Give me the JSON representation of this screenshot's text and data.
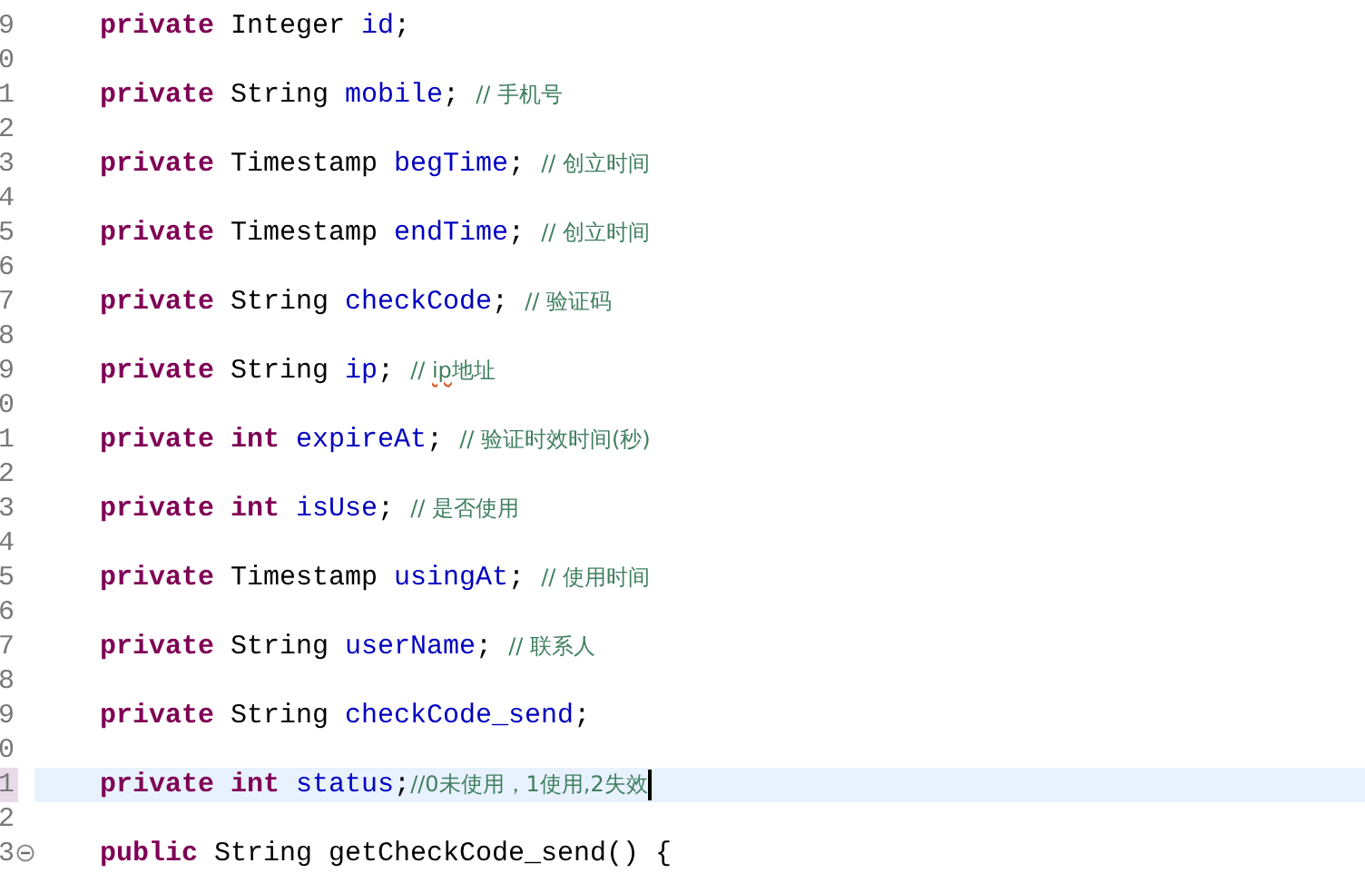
{
  "editor": {
    "lines": [
      {
        "number": "9",
        "selected": false,
        "segments": [
          {
            "kind": "keyword",
            "text": "private "
          },
          {
            "kind": "plain",
            "text": "Integer "
          },
          {
            "kind": "field",
            "text": "id"
          },
          {
            "kind": "plain",
            "text": ";"
          }
        ]
      },
      {
        "number": "0",
        "selected": false
      },
      {
        "number": "1",
        "selected": false,
        "segments": [
          {
            "kind": "keyword",
            "text": "private "
          },
          {
            "kind": "plain",
            "text": "String "
          },
          {
            "kind": "field",
            "text": "mobile"
          },
          {
            "kind": "plain",
            "text": "; "
          },
          {
            "kind": "comment",
            "text": "// 手机号"
          }
        ]
      },
      {
        "number": "2",
        "selected": false
      },
      {
        "number": "3",
        "selected": false,
        "segments": [
          {
            "kind": "keyword",
            "text": "private "
          },
          {
            "kind": "plain",
            "text": "Timestamp "
          },
          {
            "kind": "field",
            "text": "begTime"
          },
          {
            "kind": "plain",
            "text": "; "
          },
          {
            "kind": "comment",
            "text": "// 创立时间"
          }
        ]
      },
      {
        "number": "4",
        "selected": false
      },
      {
        "number": "5",
        "selected": false,
        "segments": [
          {
            "kind": "keyword",
            "text": "private "
          },
          {
            "kind": "plain",
            "text": "Timestamp "
          },
          {
            "kind": "field",
            "text": "endTime"
          },
          {
            "kind": "plain",
            "text": "; "
          },
          {
            "kind": "comment",
            "text": "// 创立时间"
          }
        ]
      },
      {
        "number": "6",
        "selected": false
      },
      {
        "number": "7",
        "selected": false,
        "segments": [
          {
            "kind": "keyword",
            "text": "private "
          },
          {
            "kind": "plain",
            "text": "String "
          },
          {
            "kind": "field",
            "text": "checkCode"
          },
          {
            "kind": "plain",
            "text": "; "
          },
          {
            "kind": "comment",
            "text": "// 验证码"
          }
        ]
      },
      {
        "number": "8",
        "selected": false
      },
      {
        "number": "9",
        "selected": false,
        "segments": [
          {
            "kind": "keyword",
            "text": "private "
          },
          {
            "kind": "plain",
            "text": "String "
          },
          {
            "kind": "field",
            "text": "ip"
          },
          {
            "kind": "plain",
            "text": "; "
          },
          {
            "kind": "comment",
            "text": "// "
          },
          {
            "kind": "misspelled",
            "text": "ip"
          },
          {
            "kind": "comment",
            "text": "地址"
          }
        ]
      },
      {
        "number": "0",
        "selected": false
      },
      {
        "number": "1",
        "selected": false,
        "segments": [
          {
            "kind": "keyword",
            "text": "private int "
          },
          {
            "kind": "field",
            "text": "expireAt"
          },
          {
            "kind": "plain",
            "text": "; "
          },
          {
            "kind": "comment",
            "text": "// 验证时效时间(秒)"
          }
        ]
      },
      {
        "number": "2",
        "selected": false
      },
      {
        "number": "3",
        "selected": false,
        "segments": [
          {
            "kind": "keyword",
            "text": "private int "
          },
          {
            "kind": "field",
            "text": "isUse"
          },
          {
            "kind": "plain",
            "text": "; "
          },
          {
            "kind": "comment",
            "text": "// 是否使用"
          }
        ]
      },
      {
        "number": "4",
        "selected": false
      },
      {
        "number": "5",
        "selected": false,
        "segments": [
          {
            "kind": "keyword",
            "text": "private "
          },
          {
            "kind": "plain",
            "text": "Timestamp "
          },
          {
            "kind": "field",
            "text": "usingAt"
          },
          {
            "kind": "plain",
            "text": "; "
          },
          {
            "kind": "comment",
            "text": "// 使用时间"
          }
        ]
      },
      {
        "number": "6",
        "selected": false
      },
      {
        "number": "7",
        "selected": false,
        "segments": [
          {
            "kind": "keyword",
            "text": "private "
          },
          {
            "kind": "plain",
            "text": "String "
          },
          {
            "kind": "field",
            "text": "userName"
          },
          {
            "kind": "plain",
            "text": "; "
          },
          {
            "kind": "comment",
            "text": "// 联系人"
          }
        ]
      },
      {
        "number": "8",
        "selected": false
      },
      {
        "number": "9",
        "selected": false,
        "segments": [
          {
            "kind": "keyword",
            "text": "private "
          },
          {
            "kind": "plain",
            "text": "String "
          },
          {
            "kind": "field",
            "text": "checkCode_send"
          },
          {
            "kind": "plain",
            "text": ";"
          }
        ]
      },
      {
        "number": "0",
        "selected": false
      },
      {
        "number": "1",
        "selected": true,
        "segments": [
          {
            "kind": "keyword",
            "text": "private int "
          },
          {
            "kind": "field",
            "text": "status"
          },
          {
            "kind": "plain",
            "text": ";"
          },
          {
            "kind": "comment",
            "text": "//0未使用，1使用,2失效"
          }
        ]
      },
      {
        "number": "2",
        "selected": false
      },
      {
        "number": "3",
        "selected": false,
        "foldable": true,
        "segments": [
          {
            "kind": "keyword",
            "text": "public "
          },
          {
            "kind": "plain",
            "text": "String getCheckCode_send() {"
          }
        ]
      }
    ]
  }
}
